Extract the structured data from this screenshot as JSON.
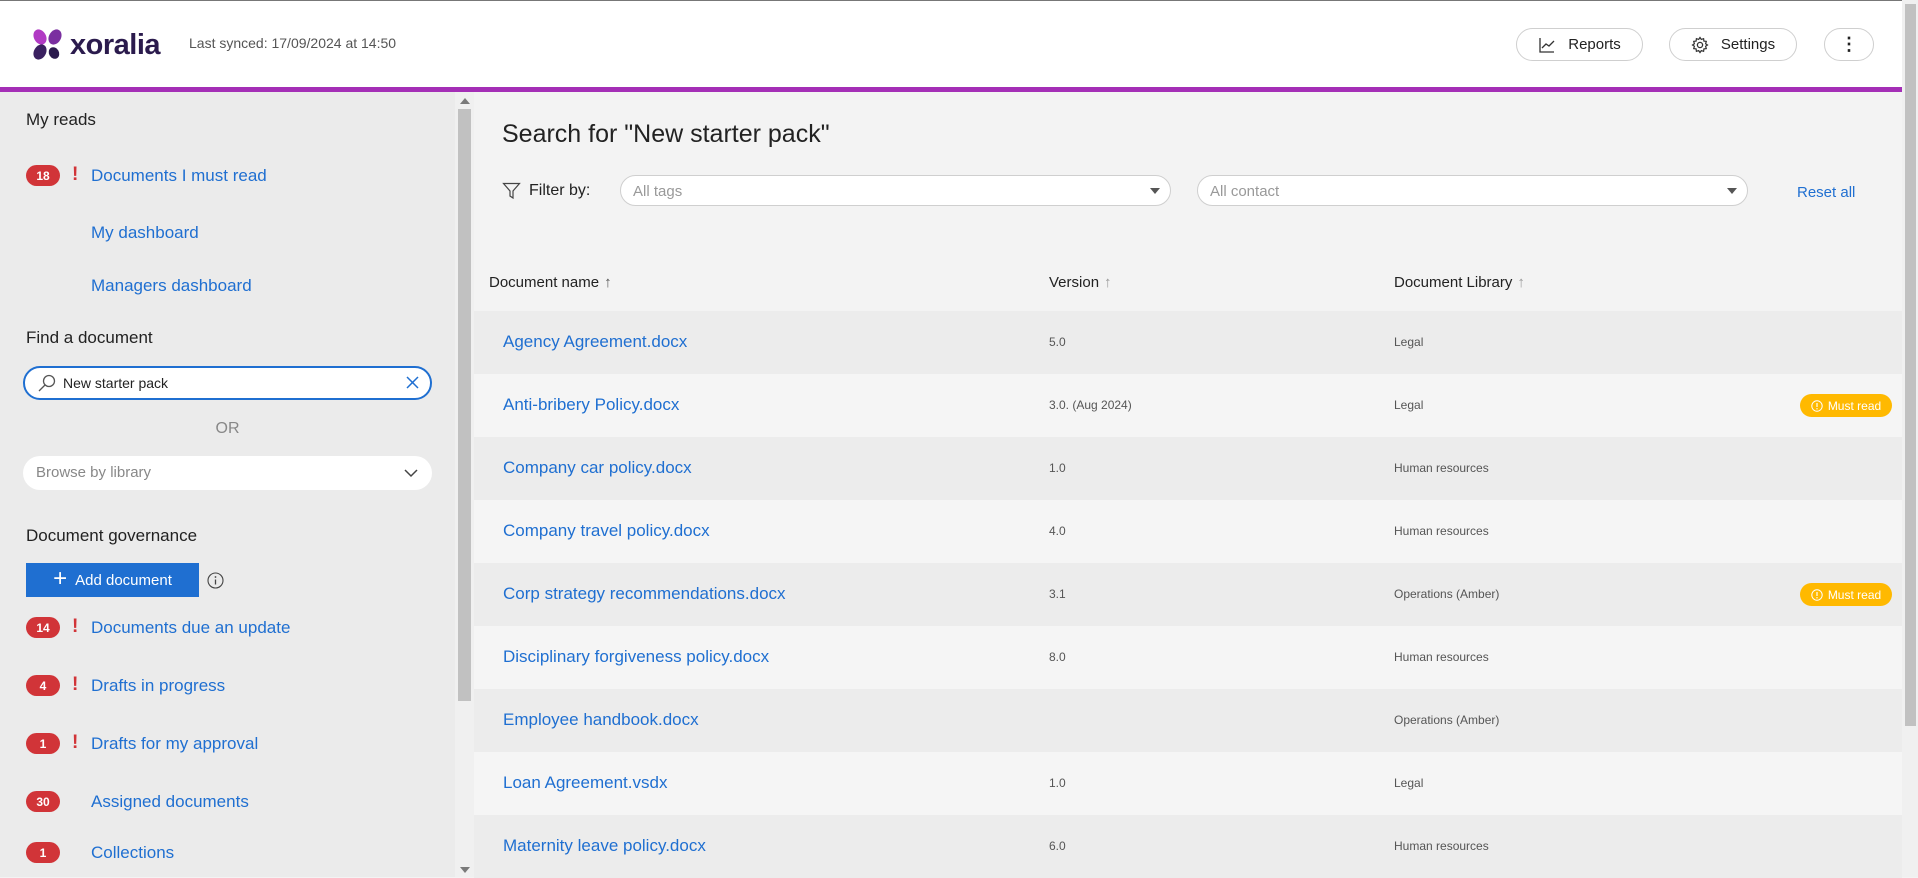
{
  "header": {
    "logo_text": "xoralia",
    "last_synced": "Last synced: 17/09/2024 at 14:50",
    "reports_label": "Reports",
    "settings_label": "Settings",
    "more_label": "⋮"
  },
  "sidebar": {
    "my_reads_heading": "My reads",
    "must_read": {
      "count": "18",
      "label": "Documents I must read"
    },
    "my_dashboard": "My dashboard",
    "managers_dashboard": "Managers dashboard",
    "find_heading": "Find a document",
    "search_value": "New starter pack",
    "or_text": "OR",
    "browse_placeholder": "Browse by library",
    "governance_heading": "Document governance",
    "add_document_label": "Add document",
    "governance_items": [
      {
        "count": "14",
        "label": "Documents due an update",
        "alert": true
      },
      {
        "count": "4",
        "label": "Drafts in progress",
        "alert": true
      },
      {
        "count": "1",
        "label": "Drafts for my approval",
        "alert": true
      },
      {
        "count": "30",
        "label": "Assigned documents",
        "alert": false
      },
      {
        "count": "1",
        "label": "Collections",
        "alert": false
      }
    ]
  },
  "main": {
    "search_title": "Search for \"New starter pack\"",
    "filter_label": "Filter by:",
    "tags_placeholder": "All tags",
    "contact_placeholder": "All contact",
    "reset_all": "Reset all",
    "columns": [
      "Document name",
      "Version",
      "Document Library"
    ],
    "sort_arrow": "↑",
    "must_read_label": "Must read",
    "rows": [
      {
        "name": "Agency Agreement.docx",
        "version": "5.0",
        "library": "Legal",
        "must_read": false
      },
      {
        "name": "Anti-bribery Policy.docx",
        "version": "3.0. (Aug 2024)",
        "library": "Legal",
        "must_read": true
      },
      {
        "name": "Company car policy.docx",
        "version": "1.0",
        "library": "Human resources",
        "must_read": false
      },
      {
        "name": "Company travel policy.docx",
        "version": "4.0",
        "library": "Human resources",
        "must_read": false
      },
      {
        "name": "Corp strategy recommendations.docx",
        "version": "3.1",
        "library": "Operations (Amber)",
        "must_read": true
      },
      {
        "name": "Disciplinary forgiveness policy.docx",
        "version": "8.0",
        "library": "Human resources",
        "must_read": false
      },
      {
        "name": "Employee handbook.docx",
        "version": "",
        "library": "Operations (Amber)",
        "must_read": false
      },
      {
        "name": "Loan Agreement.vsdx",
        "version": "1.0",
        "library": "Legal",
        "must_read": false
      },
      {
        "name": "Maternity leave policy.docx",
        "version": "6.0",
        "library": "Human resources",
        "must_read": false
      }
    ]
  },
  "colors": {
    "accent": "#a42fb6",
    "link": "#1f6fd1",
    "badge": "#d13438",
    "must_read": "#ffb900"
  }
}
